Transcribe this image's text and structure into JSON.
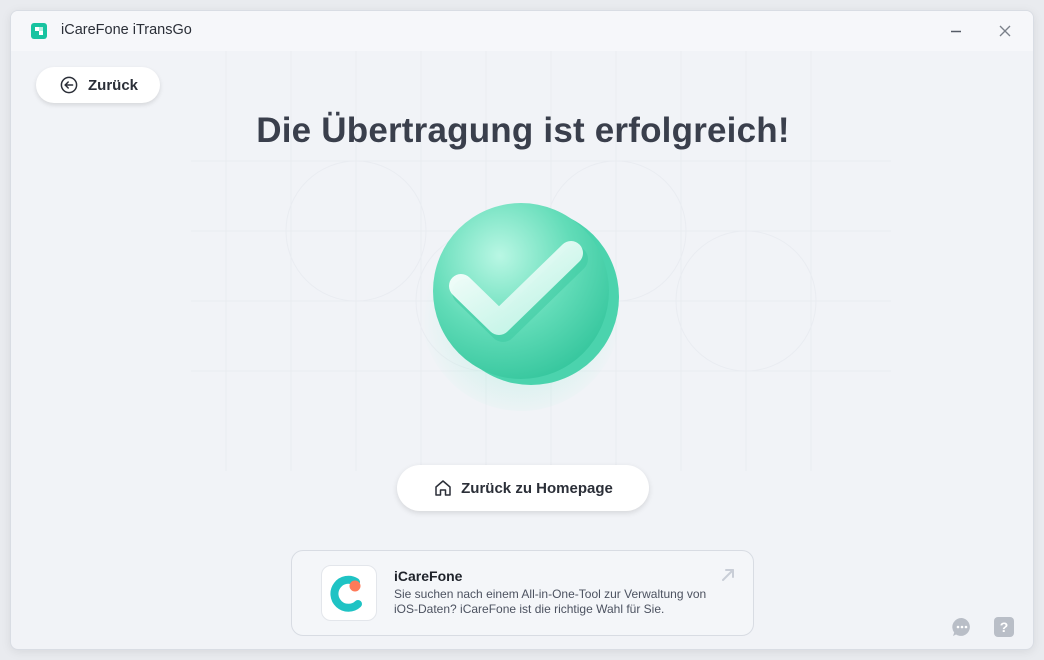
{
  "window": {
    "title": "iCareFone iTransGo",
    "minimize_icon": "minimize-icon",
    "close_icon": "close-icon"
  },
  "back_button": {
    "label": "Zurück",
    "icon": "arrow-left-circle-icon"
  },
  "headline": "Die Übertragung ist erfolgreich!",
  "status_icon": "success-checkmark-icon",
  "home_button": {
    "label": "Zurück zu Homepage",
    "icon": "home-icon"
  },
  "promo": {
    "title": "iCareFone",
    "description": "Sie suchen nach einem All-in-One-Tool zur Verwaltung von iOS-Daten? iCareFone ist die richtige Wahl für Sie.",
    "icon": "icarefone-app-icon",
    "arrow_icon": "external-arrow-icon"
  },
  "footer": {
    "chat_icon": "chat-icon",
    "help_icon": "help-icon"
  },
  "colors": {
    "accent": "#1ecba8",
    "success_green": "#6fe3c4",
    "text_dark": "#3a3f4c",
    "background": "#f1f3f7"
  }
}
